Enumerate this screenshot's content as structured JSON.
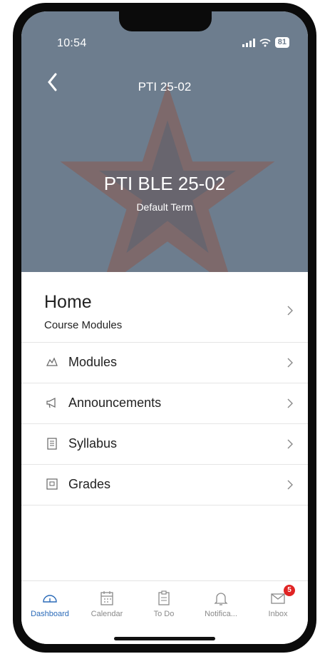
{
  "status_bar": {
    "time": "10:54",
    "battery": "81"
  },
  "nav": {
    "title": "PTI 25-02",
    "back_icon": "chevron-left-icon"
  },
  "course": {
    "name": "PTI BLE 25-02",
    "term": "Default Term"
  },
  "home": {
    "title": "Home",
    "subtitle": "Course Modules"
  },
  "menu": [
    {
      "label": "Modules",
      "icon": "modules-icon"
    },
    {
      "label": "Announcements",
      "icon": "megaphone-icon"
    },
    {
      "label": "Syllabus",
      "icon": "syllabus-icon"
    },
    {
      "label": "Grades",
      "icon": "grades-icon"
    }
  ],
  "tabbar": [
    {
      "label": "Dashboard",
      "icon": "dashboard-icon",
      "active": true
    },
    {
      "label": "Calendar",
      "icon": "calendar-icon"
    },
    {
      "label": "To Do",
      "icon": "todo-icon"
    },
    {
      "label": "Notifica...",
      "icon": "bell-icon"
    },
    {
      "label": "Inbox",
      "icon": "envelope-icon",
      "badge": "5"
    }
  ],
  "colors": {
    "hero": "#6d7d8e",
    "star": "#8a5a4e",
    "accent": "#2a6ab8",
    "badge": "#e02424"
  }
}
